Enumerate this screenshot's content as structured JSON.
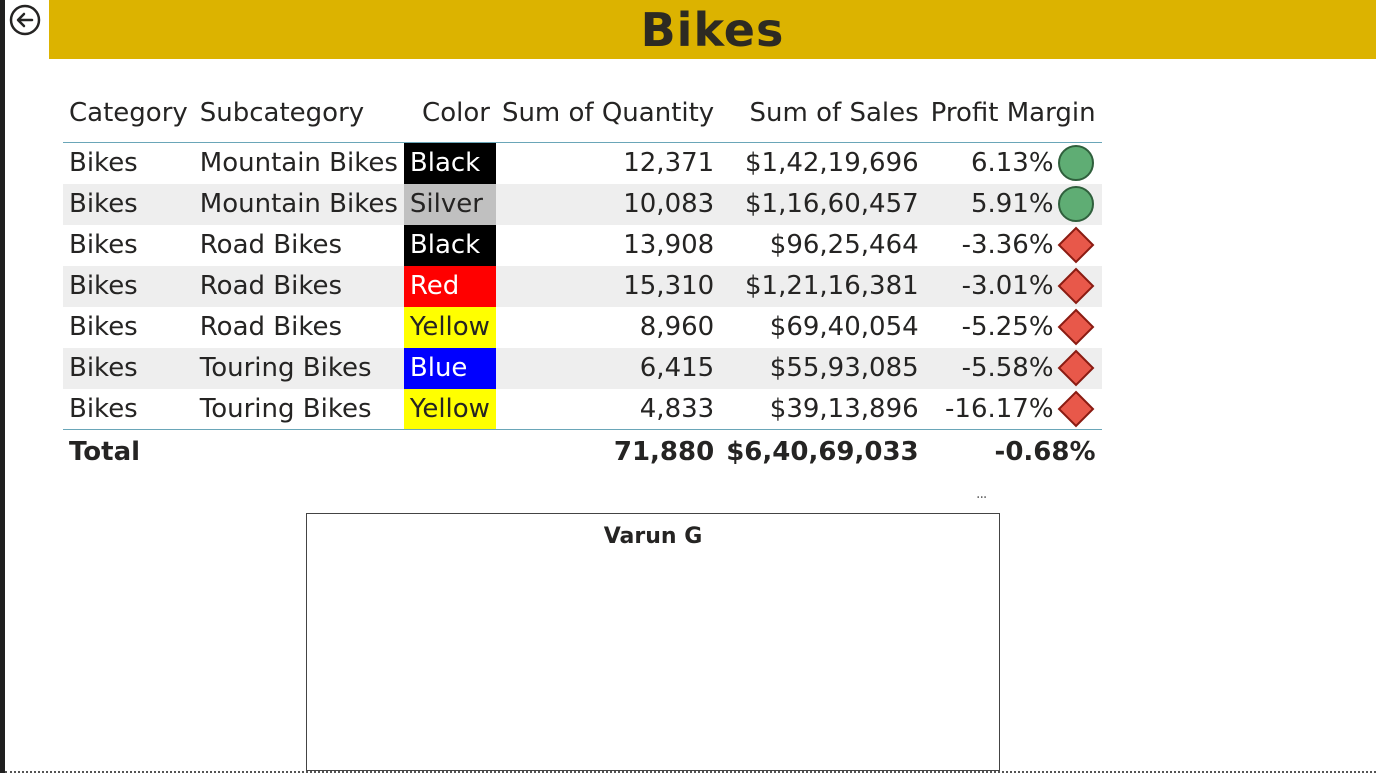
{
  "title": "Bikes",
  "colors": {
    "title_bar": "#dcb300",
    "alt_row": "#eeeeee",
    "good_indicator": "#5fad74",
    "bad_indicator": "#e8584a"
  },
  "table": {
    "headers": {
      "category": "Category",
      "subcategory": "Subcategory",
      "color": "Color",
      "quantity": "Sum of Quantity",
      "sales": "Sum of Sales",
      "profit_margin": "Profit Margin"
    },
    "rows": [
      {
        "category": "Bikes",
        "subcategory": "Mountain Bikes",
        "color": "Black",
        "color_bg": "#000000",
        "color_fg": "#ffffff",
        "quantity": "12,371",
        "sales": "$1,42,19,696",
        "profit_margin": "6.13%",
        "indicator": "green-circle"
      },
      {
        "category": "Bikes",
        "subcategory": "Mountain Bikes",
        "color": "Silver",
        "color_bg": "#c0c0c0",
        "color_fg": "#252423",
        "quantity": "10,083",
        "sales": "$1,16,60,457",
        "profit_margin": "5.91%",
        "indicator": "green-circle"
      },
      {
        "category": "Bikes",
        "subcategory": "Road Bikes",
        "color": "Black",
        "color_bg": "#000000",
        "color_fg": "#ffffff",
        "quantity": "13,908",
        "sales": "$96,25,464",
        "profit_margin": "-3.36%",
        "indicator": "red-diamond"
      },
      {
        "category": "Bikes",
        "subcategory": "Road Bikes",
        "color": "Red",
        "color_bg": "#ff0000",
        "color_fg": "#ffffff",
        "quantity": "15,310",
        "sales": "$1,21,16,381",
        "profit_margin": "-3.01%",
        "indicator": "red-diamond"
      },
      {
        "category": "Bikes",
        "subcategory": "Road Bikes",
        "color": "Yellow",
        "color_bg": "#ffff00",
        "color_fg": "#252423",
        "quantity": "8,960",
        "sales": "$69,40,054",
        "profit_margin": "-5.25%",
        "indicator": "red-diamond"
      },
      {
        "category": "Bikes",
        "subcategory": "Touring Bikes",
        "color": "Blue",
        "color_bg": "#0000ff",
        "color_fg": "#ffffff",
        "quantity": "6,415",
        "sales": "$55,93,085",
        "profit_margin": "-5.58%",
        "indicator": "red-diamond"
      },
      {
        "category": "Bikes",
        "subcategory": "Touring Bikes",
        "color": "Yellow",
        "color_bg": "#ffff00",
        "color_fg": "#252423",
        "quantity": "4,833",
        "sales": "$39,13,896",
        "profit_margin": "-16.17%",
        "indicator": "red-diamond"
      }
    ],
    "total": {
      "label": "Total",
      "quantity": "71,880",
      "sales": "$6,40,69,033",
      "profit_margin": "-0.68%"
    }
  },
  "more_options": "...",
  "card": {
    "title": "Varun G"
  }
}
